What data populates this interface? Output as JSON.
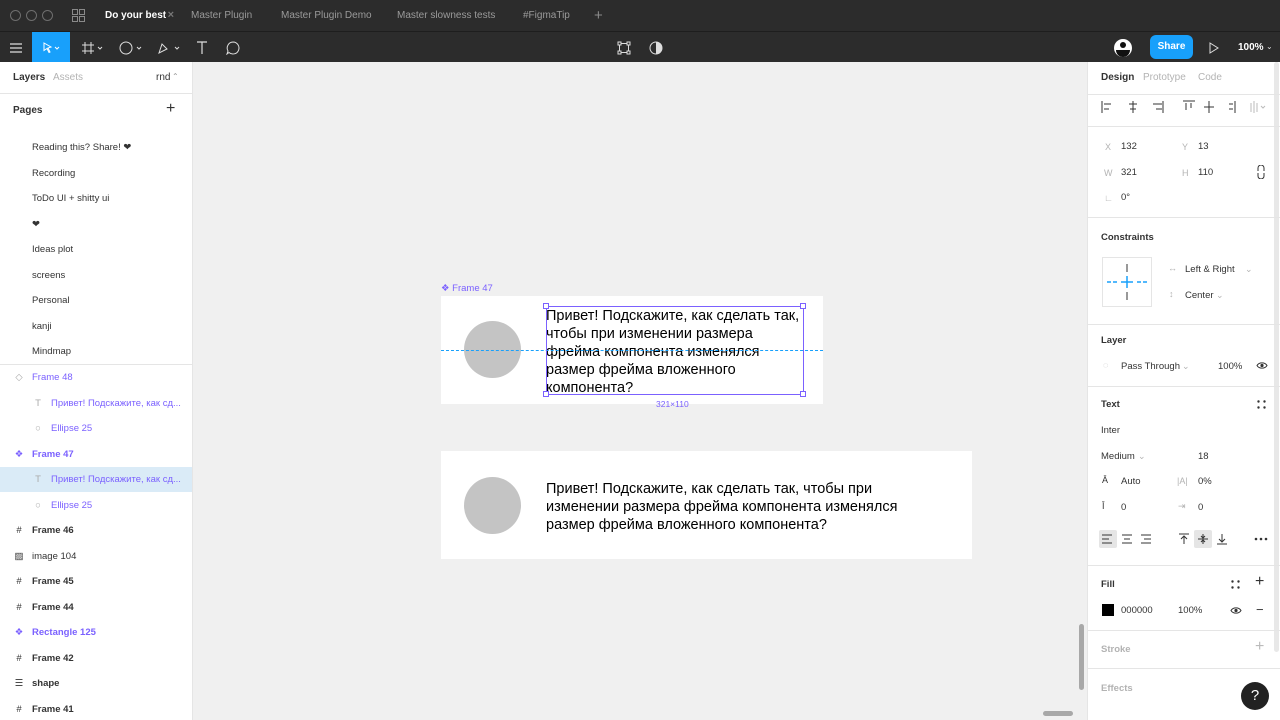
{
  "tabs": [
    {
      "label": "Do your best",
      "active": true
    },
    {
      "label": "Master Plugin",
      "active": false
    },
    {
      "label": "Master Plugin Demo",
      "active": false
    },
    {
      "label": "Master slowness tests",
      "active": false
    },
    {
      "label": "#FigmaTip",
      "active": false
    }
  ],
  "toolbar": {
    "share_label": "Share",
    "zoom": "100%"
  },
  "left_panel": {
    "tab_layers": "Layers",
    "tab_assets": "Assets",
    "page_dropdown": "rnd",
    "pages_title": "Pages",
    "pages": [
      "Reading this? Share! ❤",
      "Recording",
      "ToDo UI + shitty ui",
      "❤",
      "Ideas plot",
      "screens",
      "Personal",
      "kanji",
      "Mindmap"
    ],
    "layers": [
      {
        "label": "Frame 48",
        "icon": "component-outline-icon",
        "color": "#7b61ff",
        "indent": 0
      },
      {
        "label": "Привет! Подскажите, как сд...",
        "icon": "text-icon",
        "color": "#7b61ff",
        "indent": 1
      },
      {
        "label": "Ellipse 25",
        "icon": "ellipse-icon",
        "color": "#7b61ff",
        "indent": 1
      },
      {
        "label": "Frame 47",
        "icon": "component-icon",
        "color": "#7b61ff",
        "indent": 0,
        "bold": true
      },
      {
        "label": "Привет! Подскажите, как сд...",
        "icon": "text-icon",
        "color": "#7b61ff",
        "indent": 1,
        "selected": true
      },
      {
        "label": "Ellipse 25",
        "icon": "ellipse-icon",
        "color": "#7b61ff",
        "indent": 1
      },
      {
        "label": "Frame 46",
        "icon": "frame-icon",
        "color": "#333333",
        "indent": 0,
        "bold": true
      },
      {
        "label": "image 104",
        "icon": "image-icon",
        "color": "#333333",
        "indent": 0
      },
      {
        "label": "Frame 45",
        "icon": "frame-icon",
        "color": "#333333",
        "indent": 0,
        "bold": true
      },
      {
        "label": "Frame 44",
        "icon": "frame-icon",
        "color": "#333333",
        "indent": 0,
        "bold": true
      },
      {
        "label": "Rectangle 125",
        "icon": "component-icon",
        "color": "#7b61ff",
        "indent": 0,
        "bold": true
      },
      {
        "label": "Frame 42",
        "icon": "frame-icon",
        "color": "#333333",
        "indent": 0,
        "bold": true
      },
      {
        "label": "shape",
        "icon": "auto-layout-icon",
        "color": "#333333",
        "indent": 0,
        "bold": true
      },
      {
        "label": "Frame 41",
        "icon": "frame-icon",
        "color": "#333333",
        "indent": 0,
        "bold": true
      }
    ]
  },
  "canvas": {
    "frame_label": "Frame 47",
    "frame_text": "Привет! Подскажите, как сделать так, чтобы при изменении размера фрейма компонента изменялся размер фрейма вложенного компонента?",
    "dimension_label": "321×110",
    "frame2_text": "Привет! Подскажите, как сделать так, чтобы при изменении размера фрейма компонента изменялся размер фрейма вложенного компонента?"
  },
  "right_panel": {
    "tab_design": "Design",
    "tab_prototype": "Prototype",
    "tab_code": "Code",
    "x_label": "X",
    "x": "132",
    "y_label": "Y",
    "y": "13",
    "w_label": "W",
    "w": "321",
    "h_label": "H",
    "h": "110",
    "rotation": "0°",
    "constraints_title": "Constraints",
    "constraint_h": "Left & Right",
    "constraint_v": "Center",
    "layer_title": "Layer",
    "blend": "Pass Through",
    "opacity": "100%",
    "text_title": "Text",
    "font": "Inter",
    "weight": "Medium",
    "size": "18",
    "line_height": "Auto",
    "letter_spacing": "0%",
    "para_spacing": "0",
    "para_indent": "0",
    "fill_title": "Fill",
    "fill_hex": "000000",
    "fill_opacity": "100%",
    "stroke_title": "Stroke",
    "effects_title": "Effects"
  },
  "colors": {
    "accent": "#18a0fb",
    "component": "#7b61ff",
    "toolbar_bg": "#2c2c2c"
  }
}
